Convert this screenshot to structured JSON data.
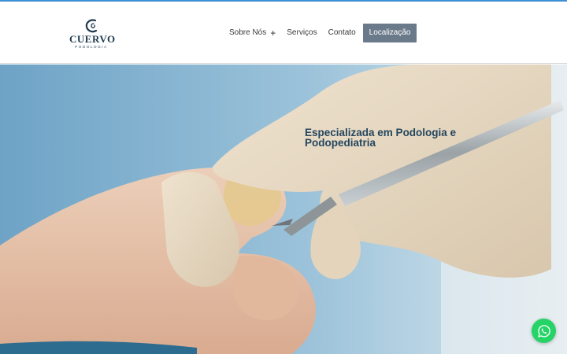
{
  "header": {
    "logo_word": "CUERVO",
    "logo_sub": "PODOLOGIA",
    "nav": {
      "about": "Sobre Nós",
      "about_toggle": "+",
      "services": "Serviços",
      "contact": "Contato",
      "location": "Localização"
    }
  },
  "hero": {
    "title_line1": "Especializada em Podologia e",
    "title_line2": "Podopediatria",
    "image": "podiatrist-gloved-hands-trimming-toenail-photo"
  },
  "icons": {
    "logo_mark": "c-swirl-icon",
    "whatsapp": "whatsapp-icon"
  },
  "colors": {
    "accent_line": "#3d8fd6",
    "brand_navy": "#1d3a4f",
    "active_nav_bg": "#6b7a8a",
    "whatsapp_green": "#25d366"
  }
}
